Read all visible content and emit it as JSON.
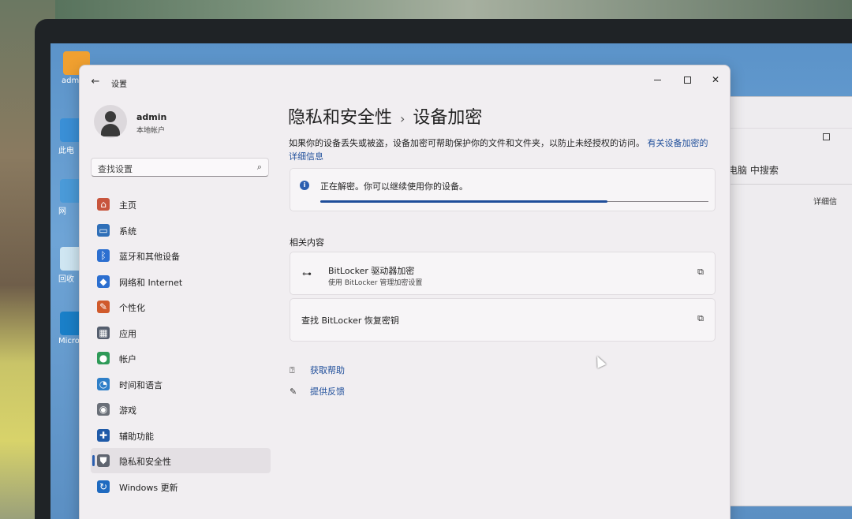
{
  "desktop": {
    "icons": [
      {
        "label": "adm",
        "color": "#f0a030"
      },
      {
        "label": "此电",
        "color": "#3a8fd6"
      },
      {
        "label": "网",
        "color": "#4a9ad8"
      },
      {
        "label": "回收",
        "color": "#cfe6f2"
      },
      {
        "label": "Micro Edg",
        "color": "#1a7fc8"
      }
    ]
  },
  "background_window": {
    "search_text": "电脑 中搜索",
    "detail_text": "详细信"
  },
  "window": {
    "app_title": "设置",
    "back_icon": "back-arrow-icon",
    "controls": {
      "minimize": "minimize-icon",
      "maximize": "maximize-icon",
      "close": "close-icon"
    }
  },
  "profile": {
    "name": "admin",
    "account_type": "本地帐户"
  },
  "search": {
    "placeholder": "查找设置",
    "icon": "search-icon"
  },
  "nav": [
    {
      "label": "主页",
      "icon": "home-icon",
      "color": "#c8553d",
      "active": false
    },
    {
      "label": "系统",
      "icon": "monitor-icon",
      "color": "#2f6fb8",
      "active": false
    },
    {
      "label": "蓝牙和其他设备",
      "icon": "bluetooth-icon",
      "color": "#2c6fd0",
      "active": false
    },
    {
      "label": "网络和 Internet",
      "icon": "wifi-icon",
      "color": "#2c6fd0",
      "active": false
    },
    {
      "label": "个性化",
      "icon": "brush-icon",
      "color": "#d05a2c",
      "active": false
    },
    {
      "label": "应用",
      "icon": "apps-icon",
      "color": "#555e6e",
      "active": false
    },
    {
      "label": "帐户",
      "icon": "person-icon",
      "color": "#2e9a58",
      "active": false
    },
    {
      "label": "时间和语言",
      "icon": "globe-clock-icon",
      "color": "#2f7fc8",
      "active": false
    },
    {
      "label": "游戏",
      "icon": "gamepad-icon",
      "color": "#6a6f78",
      "active": false
    },
    {
      "label": "辅助功能",
      "icon": "accessibility-icon",
      "color": "#1f5aa8",
      "active": false
    },
    {
      "label": "隐私和安全性",
      "icon": "shield-icon",
      "color": "#5f6570",
      "active": true
    },
    {
      "label": "Windows 更新",
      "icon": "update-icon",
      "color": "#1f6ac0",
      "active": false
    }
  ],
  "page": {
    "breadcrumb_parent": "隐私和安全性",
    "breadcrumb_sep": "›",
    "title": "设备加密",
    "description": "如果你的设备丢失或被盗，设备加密可帮助保护你的文件和文件夹，以防止未经授权的访问。",
    "description_link": "有关设备加密的详细信息",
    "status_text": "正在解密。你可以继续使用你的设备。",
    "progress": 0.74,
    "related_label": "相关内容",
    "bitlocker_title": "BitLocker 驱动器加密",
    "bitlocker_sub": "使用 BitLocker 管理加密设置",
    "recovery_title": "查找 BitLocker 恢复密钥",
    "help_label": "获取帮助",
    "feedback_label": "提供反馈"
  },
  "colors": {
    "accent": "#1f4e9a",
    "window_bg": "#f1eef1",
    "card_bg": "#f7f5f7"
  }
}
